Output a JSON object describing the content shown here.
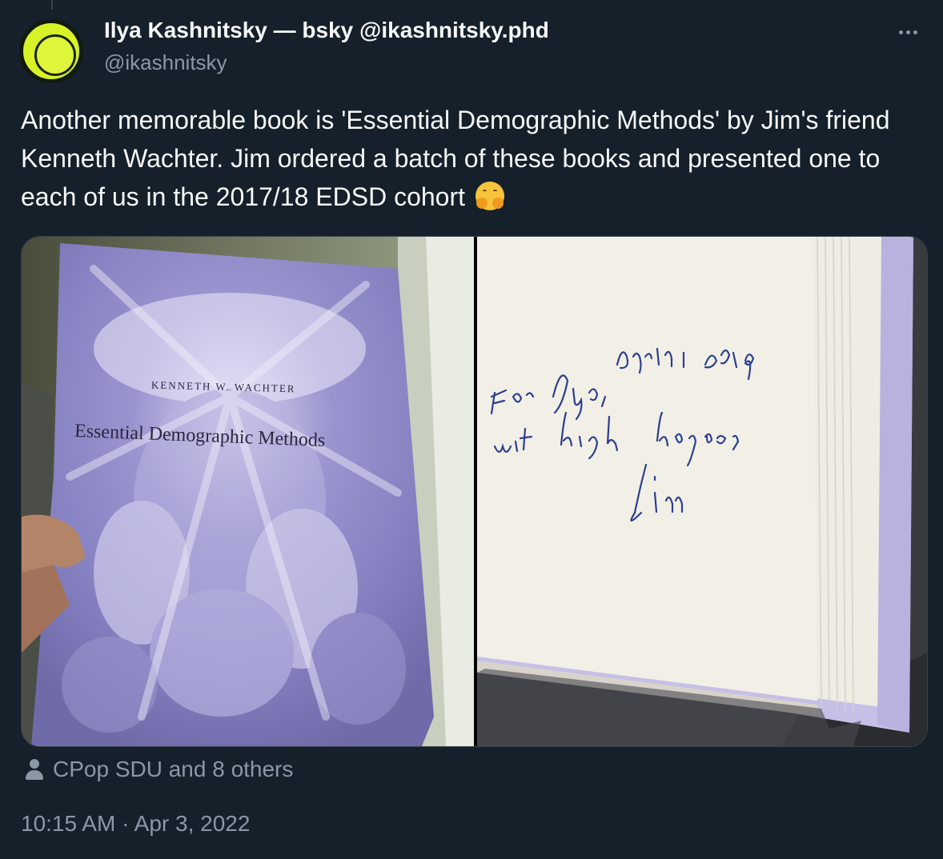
{
  "author": {
    "display_name": "Ilya Kashnitsky — bsky @ikashnitsky.phd",
    "handle": "@ikashnitsky",
    "avatar_color": "#d8f22a"
  },
  "tweet": {
    "text": "Another memorable book is 'Essential Demographic Methods' by Jim's friend Kenneth Wachter. Jim ordered a batch of these books and presented one to each of us in the 2017/18 EDSD cohort",
    "emoji": "smiling-face-with-open-hands"
  },
  "media": {
    "photo_1": {
      "cover_author": "KENNETH W. WACHTER",
      "cover_title": "Essential Demographic Methods"
    },
    "photo_2": {
      "inscription": [
        "April 2018",
        "For Ilya,",
        "with high hopes,",
        "Jim"
      ]
    }
  },
  "social": {
    "likes_text": "CPop SDU and 8 others"
  },
  "meta": {
    "timestamp": "10:15 AM · Apr 3, 2022"
  },
  "icons": {
    "more": "more-dots-icon",
    "person": "person-icon"
  }
}
